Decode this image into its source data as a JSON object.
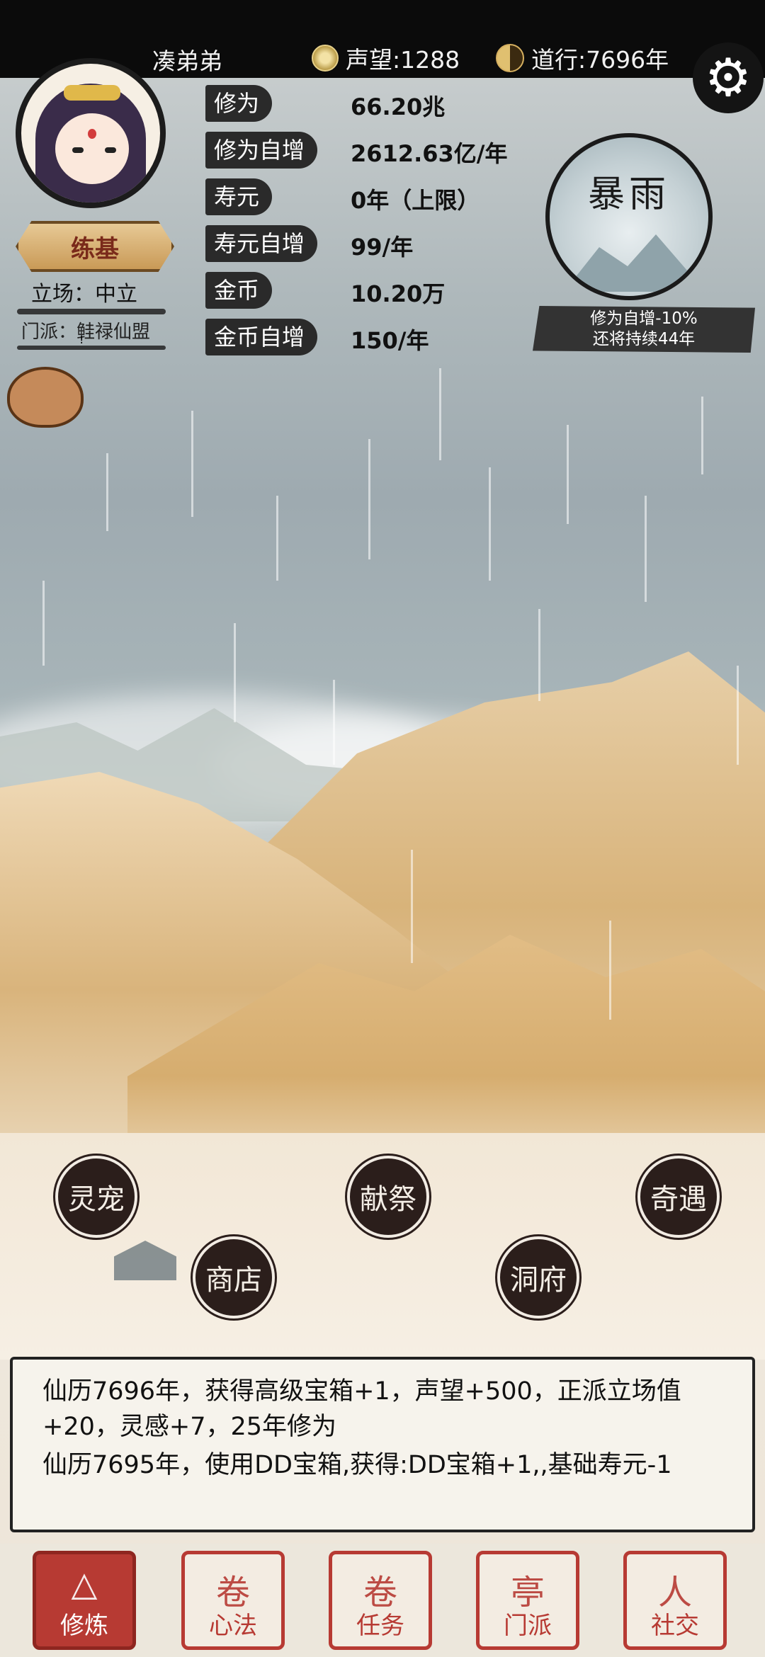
{
  "player": {
    "name": "凑弟弟",
    "realm": "练基",
    "stance": "立场：中立",
    "sect": "门派：鲑禄仙盟"
  },
  "topbar": {
    "reputation": "声望:1288",
    "dao": "道行:7696年"
  },
  "stats": [
    {
      "label": "修为",
      "value": "66.20兆"
    },
    {
      "label": "修为自增",
      "value": "2612.63亿/年"
    },
    {
      "label": "寿元",
      "value": "0年（上限）"
    },
    {
      "label": "寿元自增",
      "value": "99/年"
    },
    {
      "label": "金币",
      "value": "10.20万"
    },
    {
      "label": "金币自增",
      "value": "150/年"
    }
  ],
  "weather": {
    "title": "暴雨",
    "effect": "修为自增-10%",
    "duration": "还将持续44年"
  },
  "actions": {
    "pet": "灵宠",
    "sacrifice": "献祭",
    "adventure": "奇遇",
    "shop": "商店",
    "cave": "洞府"
  },
  "log": [
    "仙历7696年，获得高级宝箱+1，声望+500，正派立场值+20，灵感+7，25年修为",
    "仙历7695年，使用DD宝箱,获得:DD宝箱+1,,基础寿元-1"
  ],
  "nav": [
    {
      "label": "修炼",
      "glyph": "△"
    },
    {
      "label": "心法",
      "glyph": "卷"
    },
    {
      "label": "任务",
      "glyph": "卷"
    },
    {
      "label": "门派",
      "glyph": "亭"
    },
    {
      "label": "社交",
      "glyph": "人"
    }
  ],
  "icons": {
    "settings": "gear-icon",
    "reputation": "coin-icon",
    "dao": "yinyang-icon",
    "bag": "bag-icon",
    "alert": "alert-icon"
  },
  "colors": {
    "accent": "#b73a33",
    "dark": "#2b1e1b"
  }
}
